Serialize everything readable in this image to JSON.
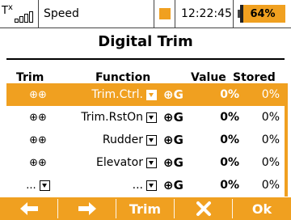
{
  "status_bar": {
    "tx_label_t": "T",
    "tx_label_x": "x",
    "model_name": "Speed",
    "time": "12:22:45",
    "battery": "64%",
    "battery_level": 0.64,
    "accent_color": "#f0a020"
  },
  "title": "Digital Trim",
  "table": {
    "headers": {
      "trim": "Trim",
      "function": "Function",
      "value": "Value",
      "stored": "Stored"
    },
    "rows": [
      {
        "trim_icon": "⊕⊕",
        "function": "Trim.Ctrl.",
        "switch": "⊕G",
        "value": "0%",
        "stored": "0%",
        "selected": true
      },
      {
        "trim_icon": "⊕⊕",
        "function": "Trim.RstOn",
        "switch": "⊕G",
        "value": "0%",
        "stored": "0%",
        "selected": false
      },
      {
        "trim_icon": "⊕⊕",
        "function": "Rudder",
        "switch": "⊕G",
        "value": "0%",
        "stored": "0%",
        "selected": false
      },
      {
        "trim_icon": "⊕⊕",
        "function": "Elevator",
        "switch": "⊕G",
        "value": "0%",
        "stored": "0%",
        "selected": false
      },
      {
        "trim_icon": "...",
        "function": "...",
        "switch": "⊕G",
        "value": "0%",
        "stored": "0%",
        "selected": false
      }
    ]
  },
  "bottom_bar": {
    "left_icon": "arrow-left-icon",
    "right_icon": "arrow-right-icon",
    "trim_label": "Trim",
    "tools_icon": "tools-icon",
    "ok_label": "Ok"
  }
}
